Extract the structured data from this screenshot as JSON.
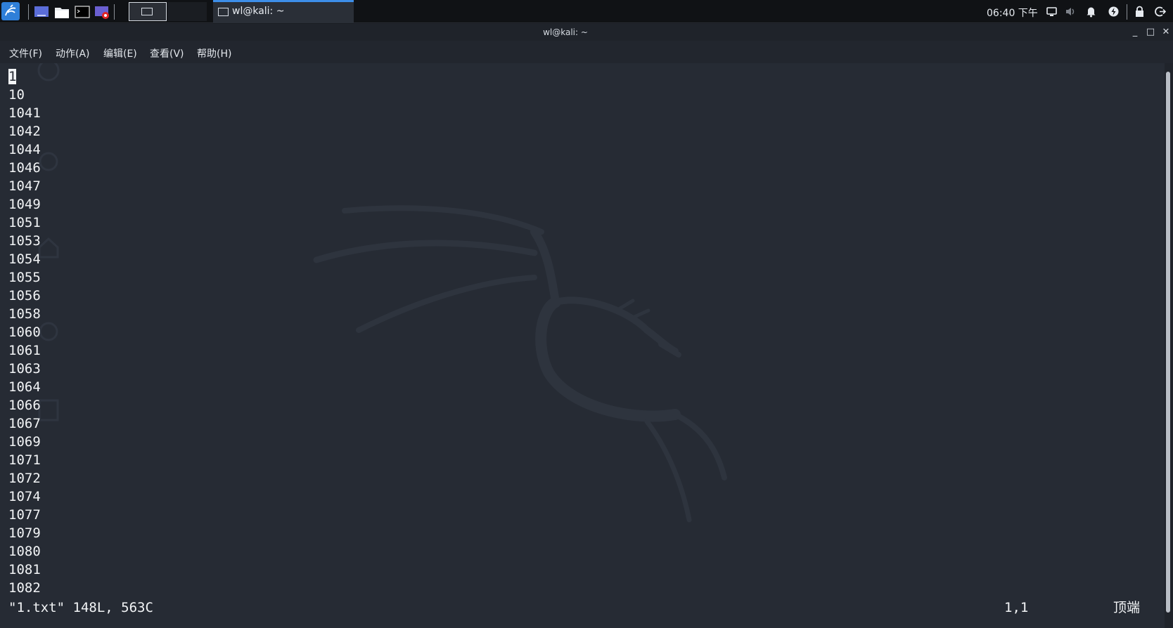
{
  "panel": {
    "task_label": "wl@kali: ~",
    "clock": "06:40 下午",
    "icons": [
      "kali-menu-icon",
      "show-desktop-icon",
      "file-manager-icon",
      "terminal-icon",
      "screen-recorder-icon",
      "workspace-icon",
      "display-icon",
      "volume-icon",
      "notification-icon",
      "power-icon",
      "lock-icon",
      "logout-icon"
    ]
  },
  "window": {
    "title": "wl@kali: ~",
    "controls": {
      "minimize": "_",
      "maximize": "□",
      "close": "✕"
    },
    "menu": [
      "文件(F)",
      "动作(A)",
      "编辑(E)",
      "查看(V)",
      "帮助(H)"
    ]
  },
  "terminal": {
    "cursor_char": "1",
    "lines": [
      "10",
      "1041",
      "1042",
      "1044",
      "1046",
      "1047",
      "1049",
      "1051",
      "1053",
      "1054",
      "1055",
      "1056",
      "1058",
      "1060",
      "1061",
      "1063",
      "1064",
      "1066",
      "1067",
      "1069",
      "1071",
      "1072",
      "1074",
      "1077",
      "1079",
      "1080",
      "1081",
      "1082"
    ],
    "status": {
      "file": "\"1.txt\" 148L, 563C",
      "position": "1,1",
      "scroll": "顶端"
    }
  },
  "colors": {
    "accent": "#3d8ee8",
    "background": "#262b34",
    "text": "#f2f4f6"
  }
}
